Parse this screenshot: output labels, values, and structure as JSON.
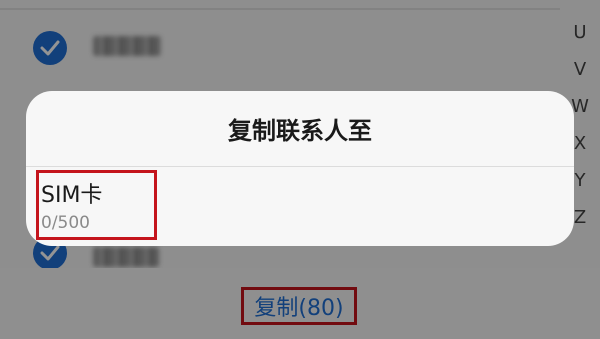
{
  "index_letters": [
    "U",
    "V",
    "W",
    "X",
    "Y",
    "Z"
  ],
  "dialog": {
    "title": "复制联系人至",
    "options": [
      {
        "label": "SIM卡",
        "count": "0/500"
      }
    ]
  },
  "bottom_bar": {
    "copy_label": "复制(80)"
  },
  "colors": {
    "accent": "#1f6fd4",
    "highlight": "#c4141c"
  }
}
